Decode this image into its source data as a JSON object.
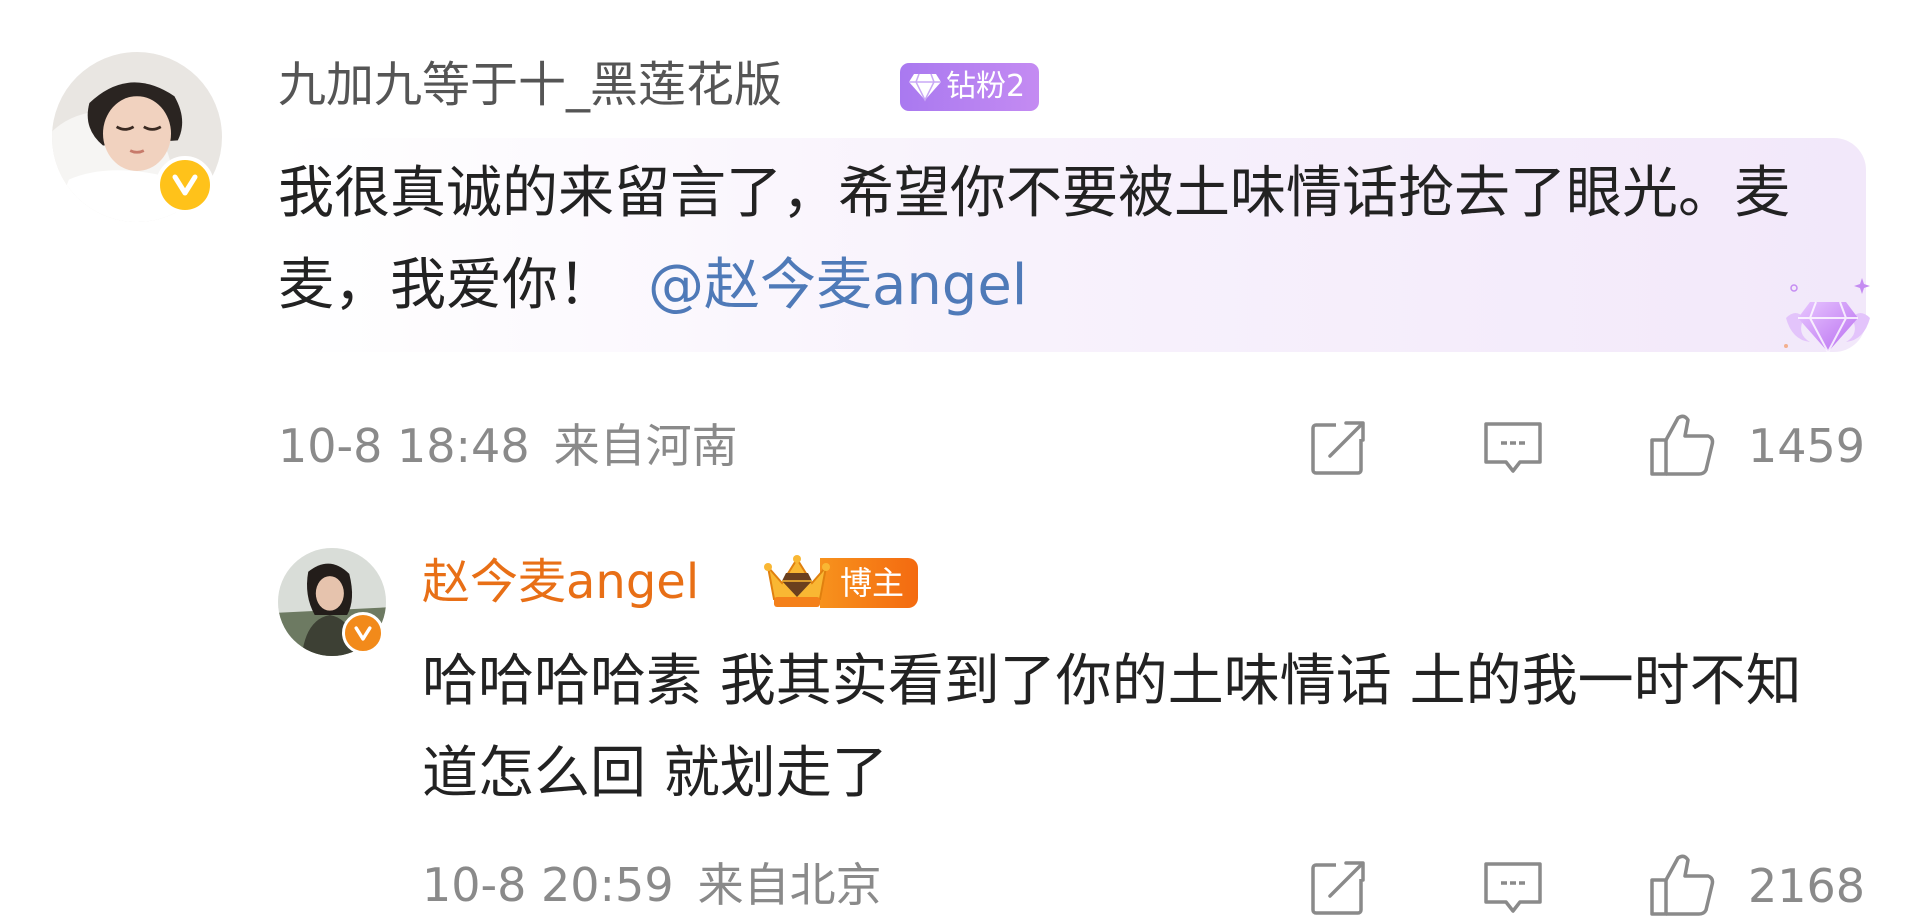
{
  "comments": [
    {
      "username": "九加九等于十_黑莲花版",
      "badge_label": "钻粉2",
      "text_before": "我很真诚的来留言了，希望你不要被土味情话抢去了眼光。麦麦，我爱你！",
      "mention": "@赵今麦angel",
      "date": "10-8 18:48",
      "location": "来自河南",
      "likes": "1459"
    },
    {
      "username": "赵今麦angel",
      "badge_label": "博主",
      "text": "哈哈哈哈素 我其实看到了你的土味情话 土的我一时不知道怎么回 就划走了",
      "date": "10-8 20:59",
      "location": "来自北京",
      "likes": "2168"
    }
  ],
  "icons": {
    "share": "share-icon",
    "comment": "comment-icon",
    "like": "like-icon",
    "verified": "verified-icon",
    "diamond": "diamond-icon",
    "crown": "crown-icon"
  },
  "colors": {
    "username_primary": "#555555",
    "username_blogger": "#e86f16",
    "mention": "#4f7ab8",
    "meta": "#8a8a8a",
    "fan_badge": "#b07ff0",
    "blogger_badge": "#f4801a",
    "verified": "#ffc21a"
  }
}
